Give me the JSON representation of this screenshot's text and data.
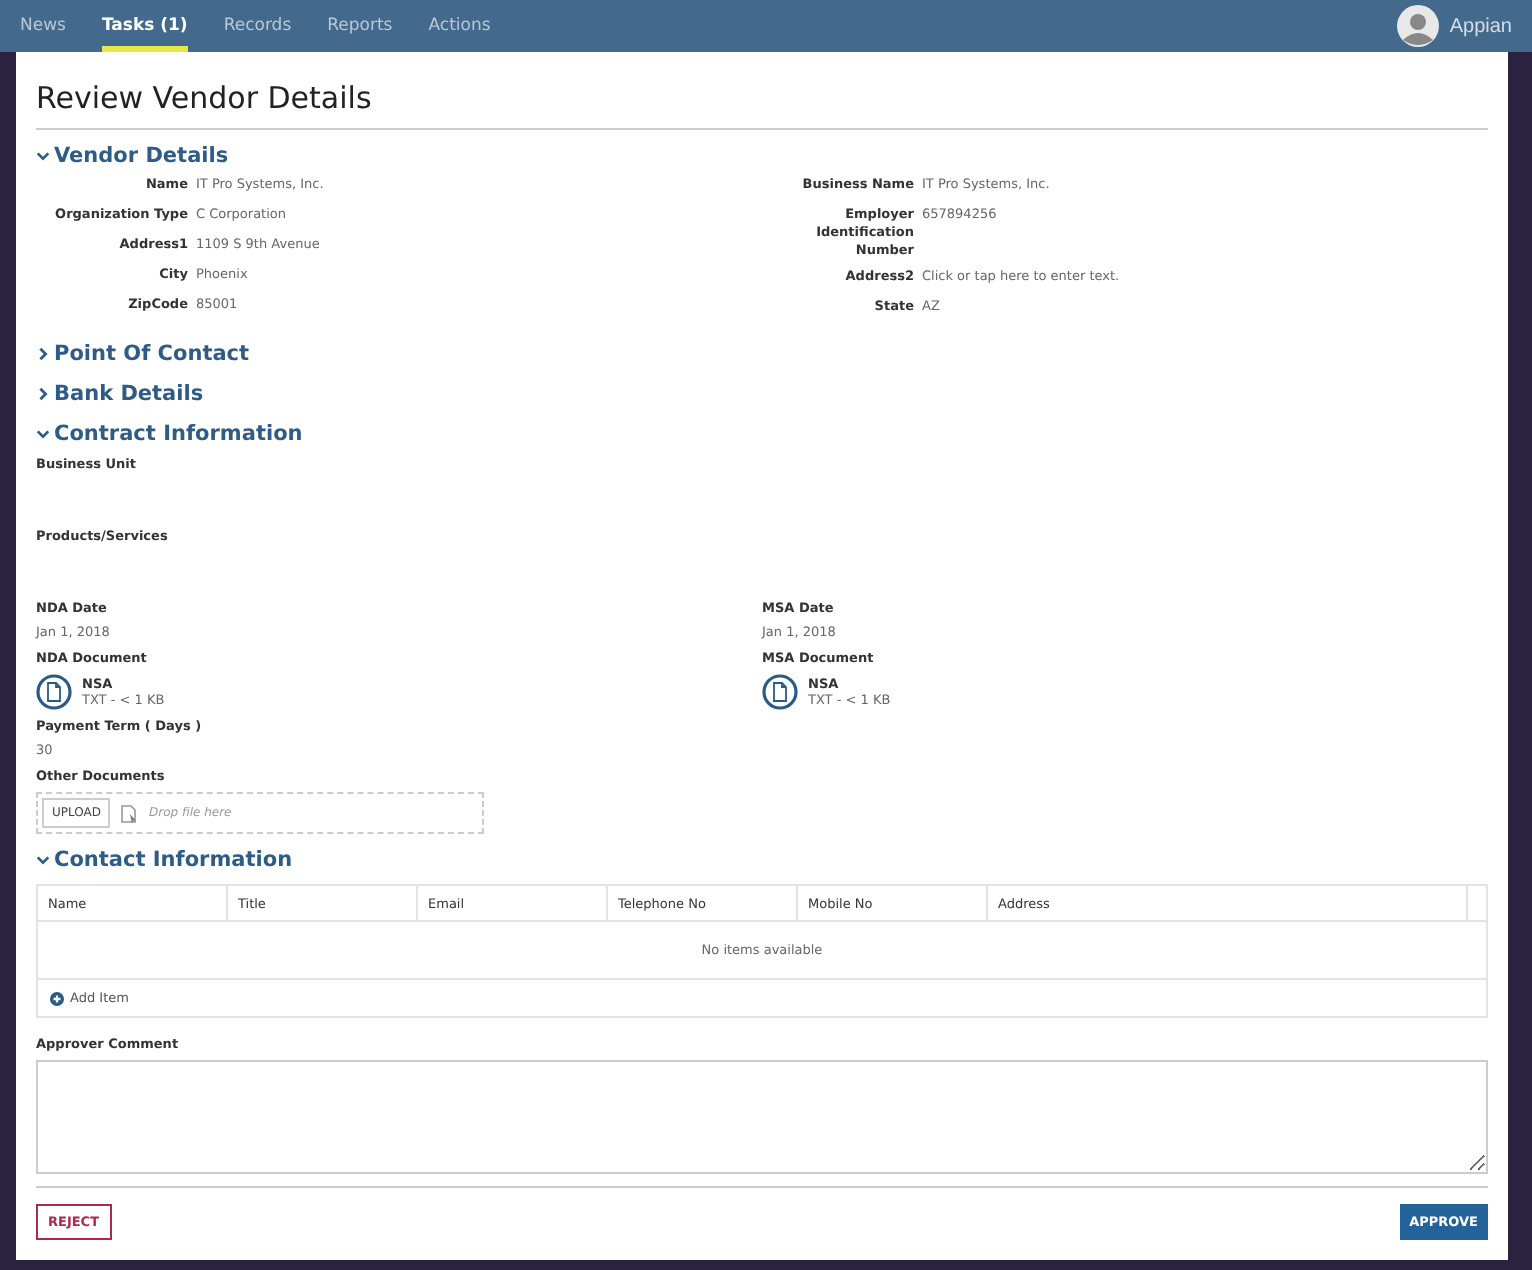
{
  "nav": {
    "items": [
      {
        "label": "News",
        "selected": false
      },
      {
        "label": "Tasks (1)",
        "selected": true
      },
      {
        "label": "Records",
        "selected": false
      },
      {
        "label": "Reports",
        "selected": false
      },
      {
        "label": "Actions",
        "selected": false
      }
    ],
    "user": "Appian"
  },
  "title": "Review Vendor Details",
  "sections": [
    {
      "kind": "fields",
      "title": "Vendor Details",
      "expanded": true,
      "columns": [
        [
          {
            "label": "Name",
            "value": "IT Pro Systems, Inc."
          },
          {
            "label": "Organization Type",
            "value": "C Corporation"
          },
          {
            "label": "Address1",
            "value": "1109 S 9th Avenue"
          },
          {
            "label": "City",
            "value": "Phoenix"
          },
          {
            "label": "ZipCode",
            "value": "85001"
          }
        ],
        [
          {
            "label": "Business Name",
            "value": "IT Pro Systems, Inc."
          },
          {
            "label": "Employer Identification Number",
            "value": "657894256"
          },
          {
            "label": "Address2",
            "value": "Click or tap here to enter text."
          },
          {
            "label": "State",
            "value": "AZ"
          }
        ]
      ]
    },
    {
      "title": "Point Of Contact",
      "expanded": false
    },
    {
      "title": "Bank Details",
      "expanded": false
    },
    {
      "kind": "contract",
      "title": "Contract Information",
      "expanded": true,
      "rows": [
        [
          {
            "kind": "text",
            "label": "Business Unit"
          }
        ],
        [
          {
            "kind": "text",
            "label": "Products/Services"
          }
        ],
        [
          {
            "kind": "text",
            "label": "NDA Date",
            "value": "Jan 1, 2018"
          },
          {
            "kind": "text",
            "label": "MSA Date",
            "value": "Jan 1, 2018"
          }
        ],
        [
          {
            "kind": "document",
            "label": "NDA Document",
            "file": "NSA",
            "meta": "TXT - < 1 KB"
          },
          {
            "kind": "document",
            "label": "MSA Document",
            "file": "NSA",
            "meta": "TXT - < 1 KB"
          }
        ],
        [
          {
            "kind": "text",
            "label": "Payment Term ( Days )",
            "value": "30"
          }
        ],
        [
          {
            "kind": "upload",
            "label": "Other Documents",
            "button": "UPLOAD",
            "hint": "Drop file here"
          }
        ]
      ]
    },
    {
      "kind": "grid",
      "title": "Contact Information",
      "expanded": true,
      "columns": [
        "Name",
        "Title",
        "Email",
        "Telephone No",
        "Mobile No",
        "Address"
      ],
      "empty": "No items available",
      "add": "Add Item"
    }
  ],
  "comment": {
    "label": "Approver Comment"
  },
  "buttons": {
    "reject": "REJECT",
    "approve": "APPROVE"
  }
}
